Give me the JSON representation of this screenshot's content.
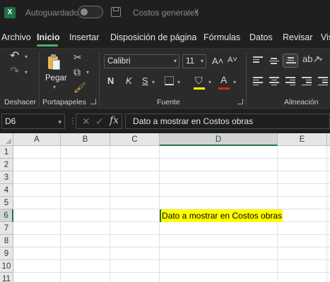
{
  "titlebar": {
    "app_icon": "X",
    "autosave_label": "Autoguardado",
    "doc_title": "Costos generales",
    "doc_chevron": "∨"
  },
  "menu": {
    "tabs": [
      "Archivo",
      "Inicio",
      "Insertar",
      "Disposición de página",
      "Fórmulas",
      "Datos",
      "Revisar",
      "Vis"
    ],
    "active_tab": "Inicio"
  },
  "ribbon": {
    "groups": {
      "undo": "Deshacer",
      "clipboard": "Portapapeles",
      "font": "Fuente",
      "alignment": "Alineación"
    },
    "paste_label": "Pegar",
    "font_name": "Calibri",
    "font_size": "11",
    "bold": "N",
    "italic": "K",
    "underline": "S",
    "grow_font": "A˄",
    "shrink_font": "A˅",
    "font_color_letter": "A",
    "highlight_color": "#ffff00",
    "font_color": "#e02020"
  },
  "formula_bar": {
    "name_box": "D6",
    "fx": "fx",
    "content": "Dato a mostrar en Costos obras"
  },
  "sheet": {
    "columns": [
      "A",
      "B",
      "C",
      "D",
      "E"
    ],
    "rows": [
      "1",
      "2",
      "3",
      "4",
      "5",
      "6",
      "7",
      "8",
      "9",
      "10",
      "11"
    ],
    "selected_column": "D",
    "selected_row": "6",
    "active_cell_text": "Dato a mostrar en Costos obras",
    "highlight": "#ffff00",
    "accent": "#217346"
  }
}
